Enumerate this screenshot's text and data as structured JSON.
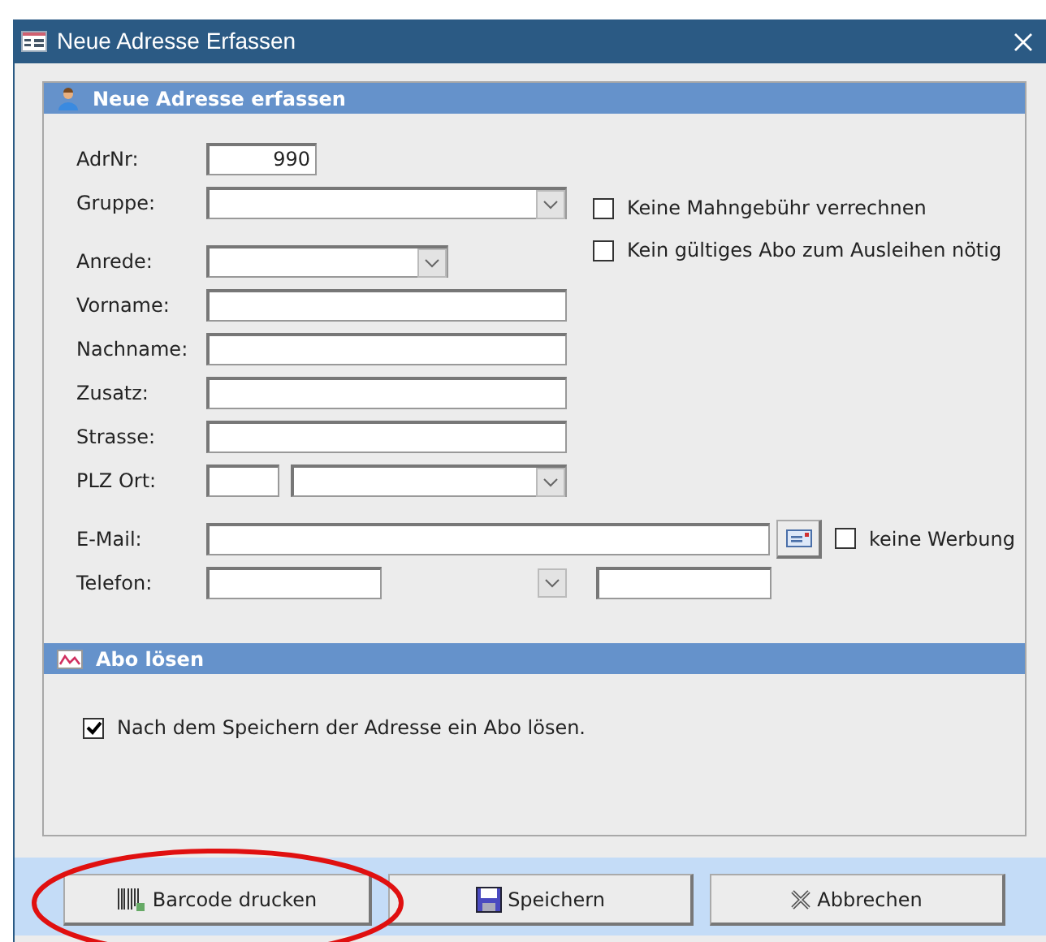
{
  "window": {
    "title": "Neue Adresse Erfassen"
  },
  "sections": [
    {
      "title": "Neue Adresse erfassen",
      "kind": "person"
    },
    {
      "title": "Abo lösen",
      "kind": "chart"
    }
  ],
  "fields": [
    {
      "label": "AdrNr:",
      "kind": "number",
      "value": "990"
    },
    {
      "label": "Gruppe:",
      "kind": "combo"
    },
    {
      "label": "Anrede:",
      "kind": "combo_short"
    },
    {
      "label": "Vorname:",
      "kind": "text"
    },
    {
      "label": "Nachname:",
      "kind": "text"
    },
    {
      "label": "Zusatz:",
      "kind": "text"
    },
    {
      "label": "Strasse:",
      "kind": "text"
    },
    {
      "label": "PLZ Ort:",
      "kind": "plz"
    }
  ],
  "options": [
    {
      "label": "Keine Mahngebühr verrechnen",
      "checked": false
    },
    {
      "label": "Kein gültiges Abo zum Ausleihen nötig",
      "checked": false
    }
  ],
  "email": {
    "label": "E-Mail:",
    "option": {
      "label": "keine Werbung",
      "checked": false
    }
  },
  "phone": {
    "label": "Telefon:"
  },
  "abo": {
    "label": "Nach dem Speichern der Adresse ein Abo lösen.",
    "checked": true
  },
  "buttons": [
    {
      "label": "Barcode drucken",
      "kind": "barcode",
      "circled": true
    },
    {
      "label": "Speichern",
      "kind": "save",
      "circled": false
    },
    {
      "label": "Abbrechen",
      "kind": "cancel",
      "circled": false
    }
  ]
}
